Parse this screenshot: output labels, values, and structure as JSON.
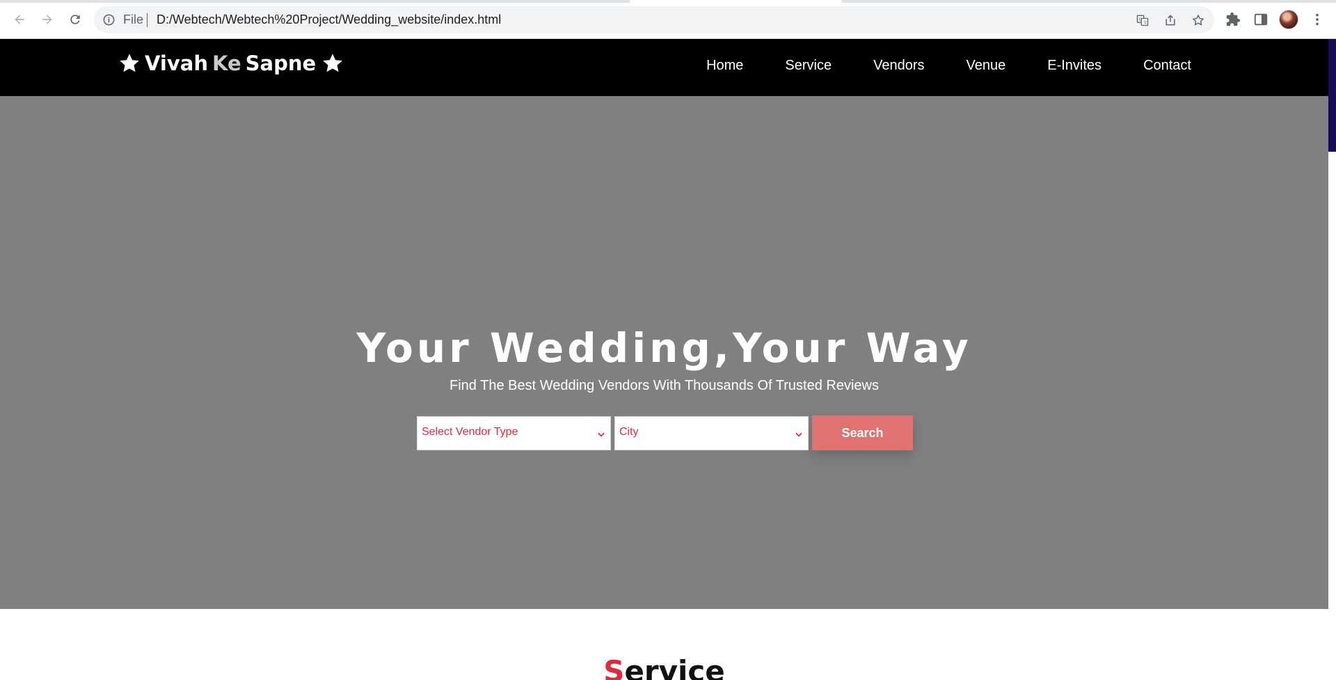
{
  "browser": {
    "scheme_label": "File",
    "url": "D:/Webtech/Webtech%20Project/Wedding_website/index.html"
  },
  "site": {
    "logo": {
      "first": "Vivah",
      "accent": "Ke",
      "last": "Sapne"
    },
    "nav": [
      "Home",
      "Service",
      "Vendors",
      "Venue",
      "E-Invites",
      "Contact"
    ]
  },
  "hero": {
    "title": "Your Wedding,Your Way",
    "subtitle": "Find The Best Wedding Vendors With Thousands Of Trusted Reviews",
    "vendor_select": "Select Vendor Type",
    "city_select": "City",
    "search_label": "Search"
  },
  "section": {
    "title_first": "S",
    "title_rest": "ervice"
  },
  "colors": {
    "nav_bg": "#000000",
    "hero_bg": "#808080",
    "accent": "#e2283f",
    "search_button": "#e07272"
  }
}
